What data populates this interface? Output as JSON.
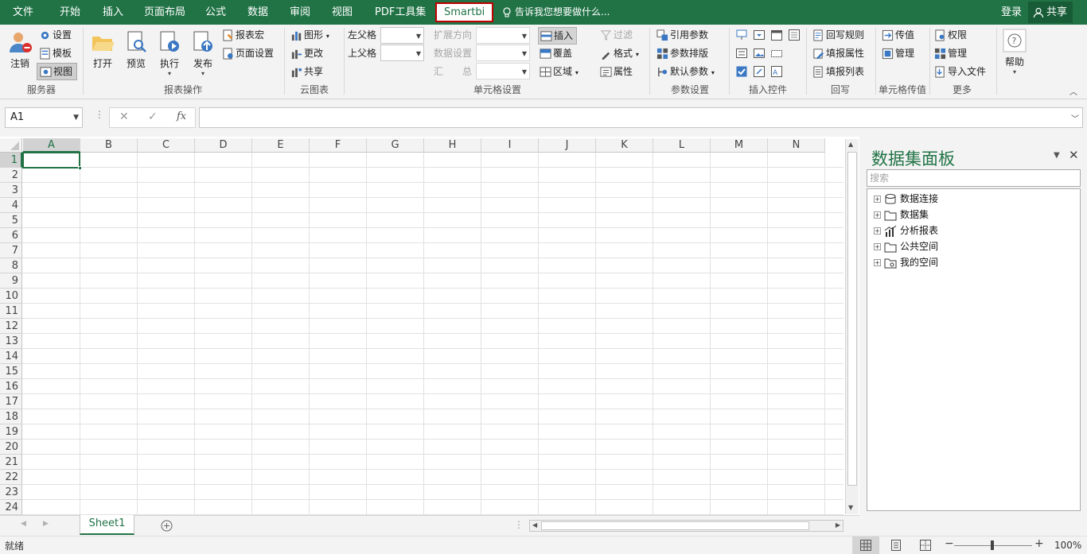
{
  "menu_tabs": [
    "文件",
    "开始",
    "插入",
    "页面布局",
    "公式",
    "数据",
    "审阅",
    "视图",
    "PDF工具集",
    "Smartbi"
  ],
  "active_tab": "Smartbi",
  "tell_me": "告诉我您想要做什么...",
  "login": "登录",
  "share": "共享",
  "ribbon": {
    "server": {
      "settings": "设置",
      "template": "模板",
      "view": "视图",
      "logout": "注销",
      "label": "服务器"
    },
    "report_ops": {
      "open": "打开",
      "preview": "预览",
      "execute": "执行",
      "publish": "发布",
      "macro": "报表宏",
      "page_setup": "页面设置",
      "label": "报表操作"
    },
    "cloud_chart": {
      "chart": "图形",
      "change": "更改",
      "share": "共享",
      "label": "云图表"
    },
    "cell_settings": {
      "left_parent": "左父格",
      "top_parent": "上父格",
      "expand_dir": "扩展方向",
      "data_settings": "数据设置",
      "summary": "汇　　总",
      "insert": "插入",
      "cover": "覆盖",
      "region": "区域",
      "filter": "过滤",
      "format": "格式",
      "attributes": "属性",
      "label": "单元格设置"
    },
    "params": {
      "ref_param": "引用参数",
      "param_layout": "参数排版",
      "default_param": "默认参数",
      "label": "参数设置"
    },
    "controls": {
      "label": "插入控件"
    },
    "writeback": {
      "rule": "回写规则",
      "fill_attr": "填报属性",
      "fill_list": "填报列表",
      "label": "回写"
    },
    "cell_transfer": {
      "transfer": "传值",
      "manage": "管理",
      "label": "单元格传值"
    },
    "more": {
      "permission": "权限",
      "manage": "管理",
      "import_file": "导入文件",
      "label": "更多"
    },
    "help": {
      "help": "帮助"
    }
  },
  "name_box": "A1",
  "fx": "fx",
  "columns": [
    "A",
    "B",
    "C",
    "D",
    "E",
    "F",
    "G",
    "H",
    "I",
    "J",
    "K",
    "L",
    "M",
    "N"
  ],
  "rows": [
    "1",
    "2",
    "3",
    "4",
    "5",
    "6",
    "7",
    "8",
    "9",
    "10",
    "11",
    "12",
    "13",
    "14",
    "15",
    "16",
    "17",
    "18",
    "19",
    "20",
    "21",
    "22",
    "23",
    "24"
  ],
  "sheet_tab": "Sheet1",
  "status": "就绪",
  "zoom": "100%",
  "panel": {
    "title": "数据集面板",
    "search_placeholder": "搜索",
    "tree": [
      "数据连接",
      "数据集",
      "分析报表",
      "公共空间",
      "我的空间"
    ]
  },
  "colors": {
    "accent": "#217346",
    "highlight": "#c00000"
  }
}
